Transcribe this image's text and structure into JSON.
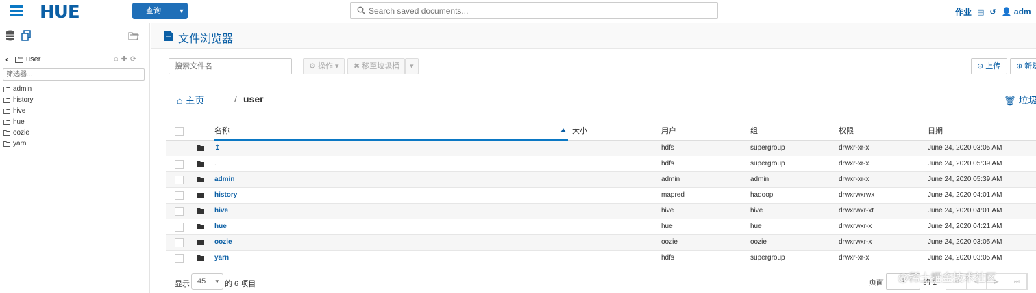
{
  "topbar": {
    "logo": "HUE",
    "query_label": "查询",
    "search_placeholder": "Search saved documents...",
    "jobs_label": "作业",
    "user_label": "adm"
  },
  "left_panel": {
    "path_name": "user",
    "filter_placeholder": "筛选器...",
    "items": [
      "admin",
      "history",
      "hive",
      "hue",
      "oozie",
      "yarn"
    ]
  },
  "main": {
    "title": "文件浏览器",
    "search_placeholder": "搜索文件名",
    "actions_label": "操作",
    "move_to_trash_label": "移至垃圾桶",
    "upload_label": "上传",
    "new_label": "新建",
    "breadcrumb_home": "主页",
    "breadcrumb_sep": "/",
    "breadcrumb_current": "user",
    "trash_label": "垃圾桶"
  },
  "table": {
    "headers": {
      "name": "名称",
      "size": "大小",
      "user": "用户",
      "group": "组",
      "perm": "权限",
      "date": "日期"
    },
    "rows": [
      {
        "name": "↥",
        "user": "hdfs",
        "group": "supergroup",
        "perm": "drwxr-xr-x",
        "date": "June 24, 2020 03:05 AM"
      },
      {
        "name": ".",
        "user": "hdfs",
        "group": "supergroup",
        "perm": "drwxr-xr-x",
        "date": "June 24, 2020 05:39 AM"
      },
      {
        "name": "admin",
        "user": "admin",
        "group": "admin",
        "perm": "drwxr-xr-x",
        "date": "June 24, 2020 05:39 AM"
      },
      {
        "name": "history",
        "user": "mapred",
        "group": "hadoop",
        "perm": "drwxrwxrwx",
        "date": "June 24, 2020 04:01 AM"
      },
      {
        "name": "hive",
        "user": "hive",
        "group": "hive",
        "perm": "drwxrwxr-xt",
        "date": "June 24, 2020 04:01 AM"
      },
      {
        "name": "hue",
        "user": "hue",
        "group": "hue",
        "perm": "drwxrwxr-x",
        "date": "June 24, 2020 04:21 AM"
      },
      {
        "name": "oozie",
        "user": "oozie",
        "group": "oozie",
        "perm": "drwxrwxr-x",
        "date": "June 24, 2020 03:05 AM"
      },
      {
        "name": "yarn",
        "user": "hdfs",
        "group": "supergroup",
        "perm": "drwxr-xr-x",
        "date": "June 24, 2020 03:05 AM"
      }
    ]
  },
  "footer": {
    "show_label": "显示",
    "page_size": "45",
    "items_label": "的 6 项目",
    "page_label": "页面",
    "page_value": "1",
    "of_label": "的 1"
  },
  "watermark": "@稀土掘金技术社区",
  "colors": {
    "accent": "#0b5fa5",
    "button": "#1f6fb8"
  }
}
